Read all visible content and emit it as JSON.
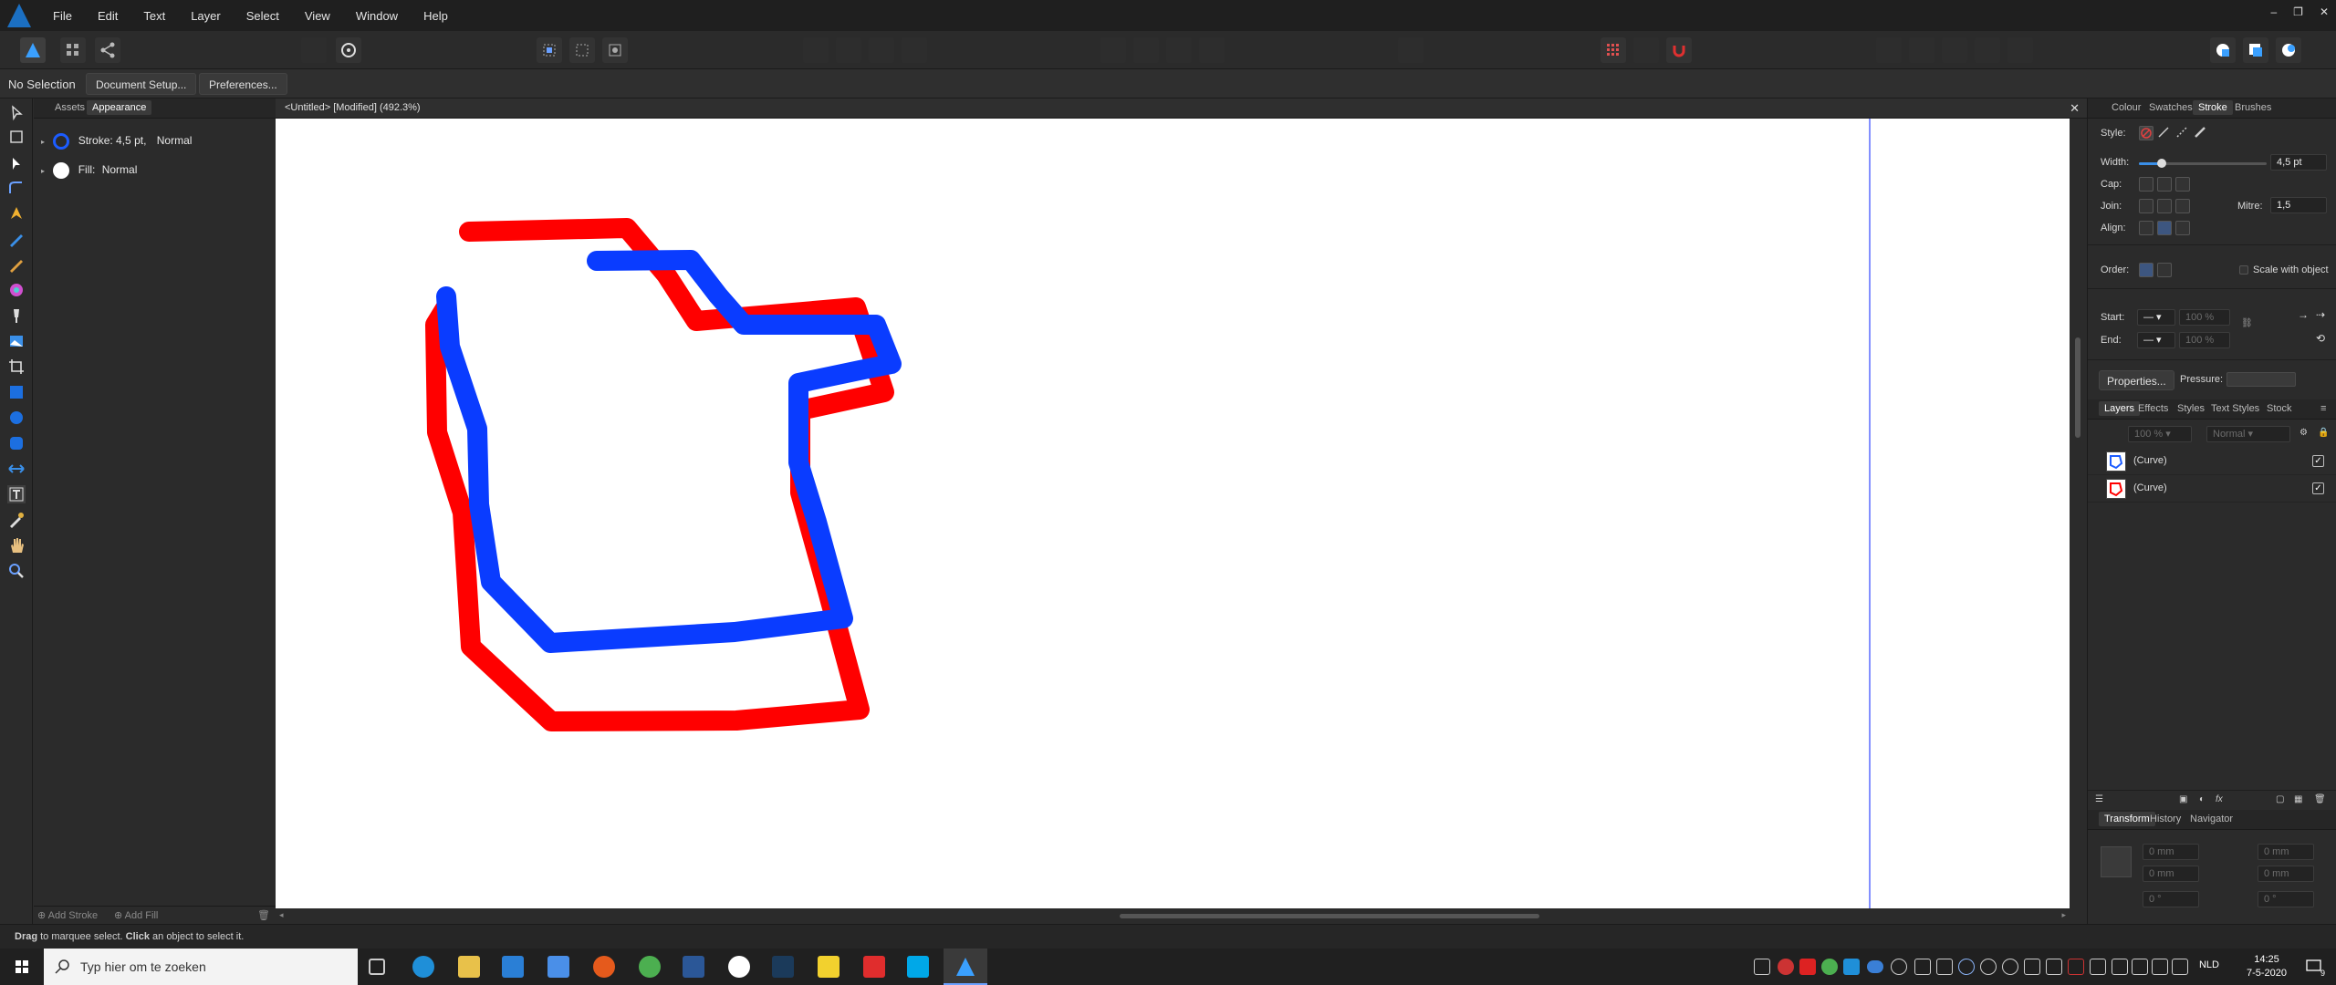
{
  "menu": {
    "items": [
      "File",
      "Edit",
      "Text",
      "Layer",
      "Select",
      "View",
      "Window",
      "Help"
    ]
  },
  "window_controls": {
    "minimize": "–",
    "restore": "❐",
    "close": "✕"
  },
  "context": {
    "selection": "No Selection",
    "document_setup": "Document Setup...",
    "preferences": "Preferences..."
  },
  "left_panel": {
    "tabs": [
      "Assets",
      "Appearance"
    ],
    "stroke": {
      "label": "Stroke: 4,5 pt,",
      "blend": "Normal",
      "color": "#1c5cff"
    },
    "fill": {
      "label": "Fill:",
      "blend": "Normal",
      "color": "#ffffff"
    },
    "add_stroke": "Add Stroke",
    "add_fill": "Add Fill"
  },
  "document": {
    "title": "<Untitled> [Modified] (492.3%)",
    "close": "✕",
    "curves": [
      {
        "name": "red-curve",
        "color": "#ff0000"
      },
      {
        "name": "blue-curve",
        "color": "#0a3cff"
      }
    ]
  },
  "right_panel": {
    "top_tabs": [
      "Colour",
      "Swatches",
      "Stroke",
      "Brushes"
    ],
    "style_label": "Style:",
    "width_label": "Width:",
    "width_value": "4,5 pt",
    "width_slider_fraction": 0.18,
    "cap_label": "Cap:",
    "join_label": "Join:",
    "mitre_label": "Mitre:",
    "mitre_value": "1,5",
    "align_label": "Align:",
    "order_label": "Order:",
    "scale_with_object": "Scale with object",
    "start_label": "Start:",
    "end_label": "End:",
    "start_percent": "100 %",
    "end_percent": "100 %",
    "properties_button": "Properties...",
    "pressure_label": "Pressure:",
    "layer_tabs": [
      "Layers",
      "Effects",
      "Styles",
      "Text Styles",
      "Stock"
    ],
    "opacity": "100 %",
    "blend_mode": "Normal",
    "layers": [
      {
        "name": "(Curve)",
        "thumb_color": "#1c5cff"
      },
      {
        "name": "(Curve)",
        "thumb_color": "#ff0000"
      }
    ],
    "bottom_tabs": [
      "Transform",
      "History",
      "Navigator"
    ],
    "transform_fields": [
      "0 mm",
      "0 mm",
      "0 mm",
      "0 mm",
      "0 °",
      "0 °"
    ]
  },
  "status": {
    "drag": "Drag",
    "drag_rest": " to marquee select. ",
    "click": "Click",
    "click_rest": " an object to select it."
  },
  "taskbar": {
    "search_placeholder": "Typ hier om te zoeken",
    "language": "NLD",
    "time": "14:25",
    "date": "7-5-2020",
    "notification_count": "9"
  }
}
